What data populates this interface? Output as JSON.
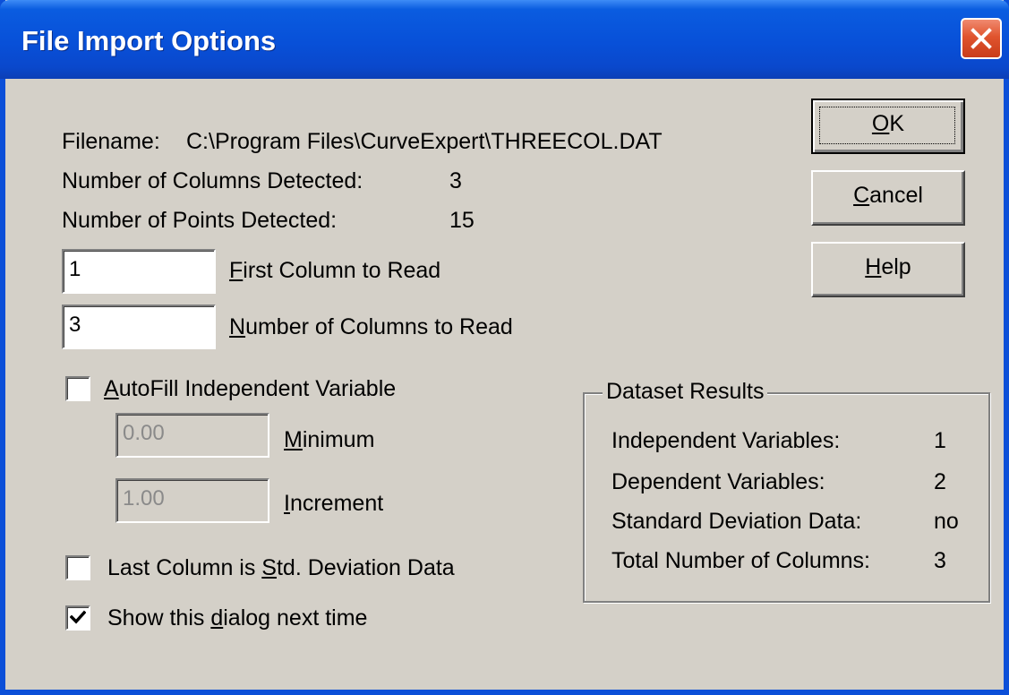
{
  "window": {
    "title": "File Import Options"
  },
  "info": {
    "filename_label": "Filename:",
    "filename_value": "C:\\Program Files\\CurveExpert\\THREECOL.DAT",
    "columns_detected_label": "Number of Columns Detected:",
    "columns_detected_value": "3",
    "points_detected_label": "Number of Points Detected:",
    "points_detected_value": "15"
  },
  "fields": {
    "first_column": {
      "value": "1",
      "label_key": "F",
      "label_rest": "irst Column to Read"
    },
    "num_columns": {
      "value": "3",
      "label_key": "N",
      "label_rest": "umber of Columns to Read"
    },
    "minimum": {
      "value": "0.00",
      "label_key": "M",
      "label_rest": "inimum"
    },
    "increment": {
      "value": "1.00",
      "label_key": "I",
      "label_rest": "ncrement"
    }
  },
  "checkboxes": {
    "autofill": {
      "checked": false,
      "label_key": "A",
      "label_rest": "utoFill Independent Variable"
    },
    "last_column_std": {
      "checked": false,
      "label_pre": "Last Column is ",
      "label_key": "S",
      "label_rest": "td. Deviation Data"
    },
    "show_dialog": {
      "checked": true,
      "label_pre": "Show this ",
      "label_key": "d",
      "label_rest": "ialog next time"
    }
  },
  "buttons": {
    "ok": {
      "key": "O",
      "rest": "K"
    },
    "cancel": {
      "key": "C",
      "rest": "ancel"
    },
    "help": {
      "key": "H",
      "rest": "elp"
    }
  },
  "dataset_results": {
    "title": "Dataset Results",
    "rows": [
      {
        "label": "Independent Variables:",
        "value": "1"
      },
      {
        "label": "Dependent Variables:",
        "value": "2"
      },
      {
        "label": "Standard Deviation Data:",
        "value": "no"
      },
      {
        "label": "Total Number of Columns:",
        "value": "3"
      }
    ]
  },
  "colors": {
    "titlebar": "#0850d8",
    "face": "#d4d0c8",
    "close": "#e0542e"
  }
}
